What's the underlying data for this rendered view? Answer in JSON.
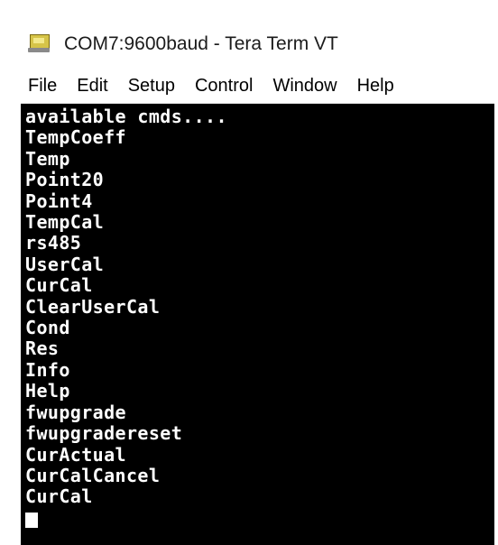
{
  "window": {
    "title": "COM7:9600baud - Tera Term VT"
  },
  "menu": {
    "items": [
      "File",
      "Edit",
      "Setup",
      "Control",
      "Window",
      "Help"
    ]
  },
  "terminal": {
    "lines": [
      "available cmds....",
      "TempCoeff",
      "Temp",
      "Point20",
      "Point4",
      "TempCal",
      "rs485",
      "UserCal",
      "CurCal",
      "ClearUserCal",
      "Cond",
      "Res",
      "Info",
      "Help",
      "fwupgrade",
      "fwupgradereset",
      "CurActual",
      "CurCalCancel",
      "CurCal"
    ],
    "background_color": "#000000",
    "text_color": "#ffffff"
  },
  "icons": {
    "app_icon": "teraterm-app-icon",
    "cursor": "block-cursor"
  }
}
